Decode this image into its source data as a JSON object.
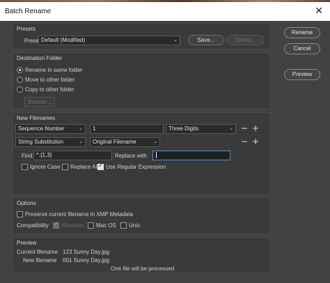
{
  "window": {
    "title": "Batch Rename",
    "close_icon": "close-icon"
  },
  "side_buttons": {
    "rename": "Rename",
    "cancel": "Cancel",
    "preview": "Preview"
  },
  "presets": {
    "title": "Presets",
    "label": "Preset",
    "selected": "Default (Modified)",
    "save": "Save...",
    "delete": "Delete..."
  },
  "destination": {
    "title": "Destination Folder",
    "options": [
      "Rename in same folder",
      "Move to other folder",
      "Copy to other folder"
    ],
    "selected_index": 0,
    "browse": "Browse..."
  },
  "new_filenames": {
    "title": "New Filenames",
    "row1": {
      "type": "Sequence Number",
      "value": "1",
      "digits": "Three Digits"
    },
    "row2": {
      "type": "String Substitution",
      "source": "Original Filename"
    },
    "find_label": "Find",
    "find_value": "^.{1,3}",
    "replace_label": "Replace with",
    "replace_value": "",
    "ignore_case": "Ignore Case",
    "replace_all": "Replace All",
    "use_regex": "Use Regular Expression",
    "use_regex_checked": true,
    "minus": "−",
    "plus": "+"
  },
  "options": {
    "title": "Options",
    "preserve": "Preserve current filename in XMP Metadata",
    "compat_label": "Compatibility",
    "windows": "Windows",
    "macos": "Mac OS",
    "unix": "Unix"
  },
  "preview": {
    "title": "Preview",
    "current_label": "Current filename",
    "current_value": "123 Sunny Day.jpg",
    "new_label": "New filename",
    "new_value": "001 Sunny Day.jpg",
    "status": "One file will be processed"
  }
}
